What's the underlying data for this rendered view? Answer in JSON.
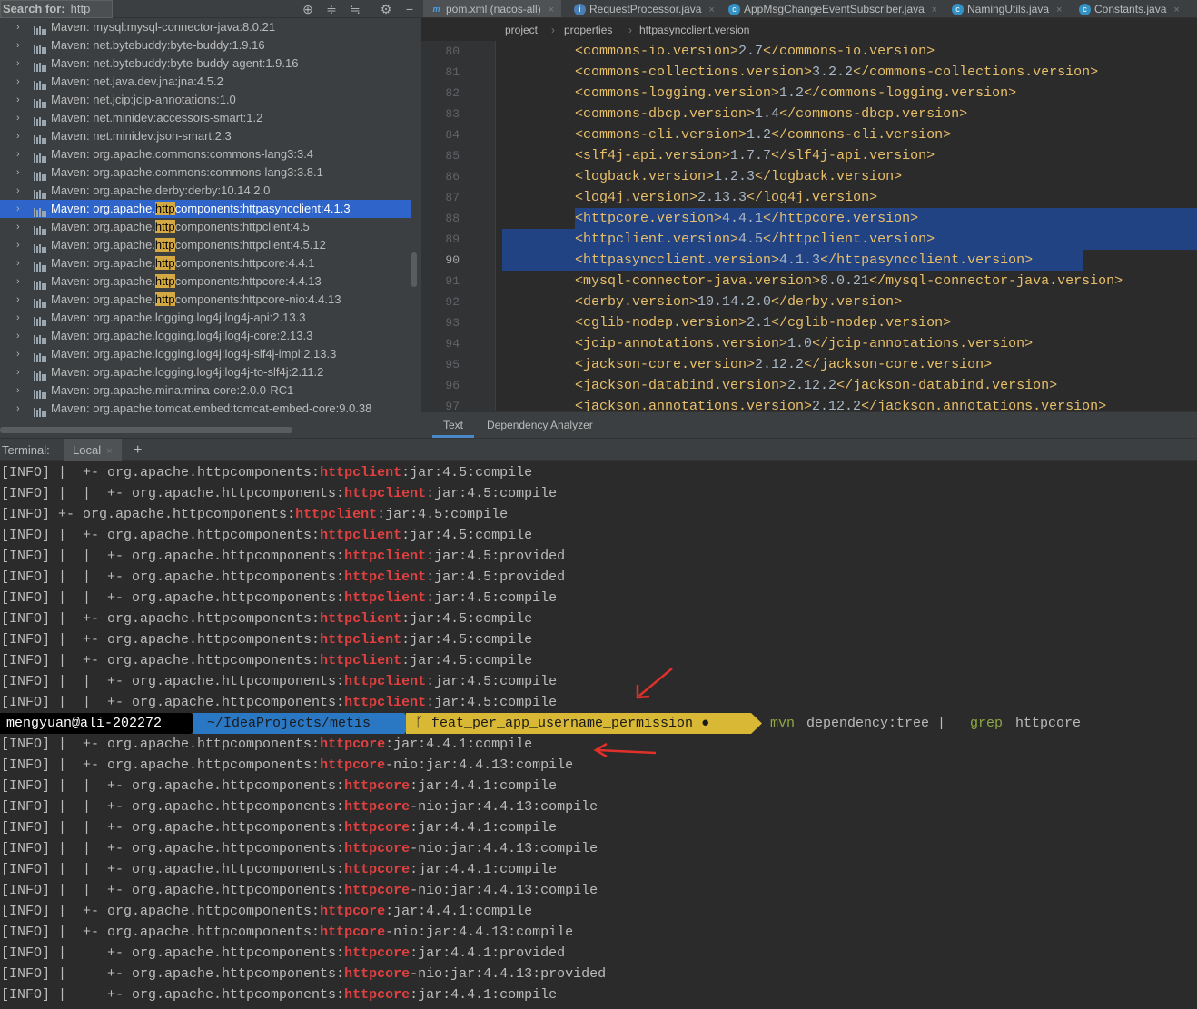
{
  "search": {
    "label": "Search for:",
    "value": "http"
  },
  "toolbar_icons": [
    "crosshair-icon",
    "expand-all-icon",
    "collapse-all-icon",
    "gear-icon",
    "minimize-icon"
  ],
  "tree": [
    {
      "text": "Maven: mysql:mysql-connector-java:8.0.21"
    },
    {
      "text": "Maven: net.bytebuddy:byte-buddy:1.9.16"
    },
    {
      "text": "Maven: net.bytebuddy:byte-buddy-agent:1.9.16"
    },
    {
      "text": "Maven: net.java.dev.jna:jna:4.5.2"
    },
    {
      "text": "Maven: net.jcip:jcip-annotations:1.0"
    },
    {
      "text": "Maven: net.minidev:accessors-smart:1.2"
    },
    {
      "text": "Maven: net.minidev:json-smart:2.3"
    },
    {
      "text": "Maven: org.apache.commons:commons-lang3:3.4"
    },
    {
      "text": "Maven: org.apache.commons:commons-lang3:3.8.1"
    },
    {
      "text": "Maven: org.apache.derby:derby:10.14.2.0"
    },
    {
      "pre": "Maven: org.apache.",
      "hl": "http",
      "post": "components:httpasyncclient:4.1.3",
      "selected": true
    },
    {
      "pre": "Maven: org.apache.",
      "hl": "http",
      "post": "components:httpclient:4.5"
    },
    {
      "pre": "Maven: org.apache.",
      "hl": "http",
      "post": "components:httpclient:4.5.12"
    },
    {
      "pre": "Maven: org.apache.",
      "hl": "http",
      "post": "components:httpcore:4.4.1"
    },
    {
      "pre": "Maven: org.apache.",
      "hl": "http",
      "post": "components:httpcore:4.4.13"
    },
    {
      "pre": "Maven: org.apache.",
      "hl": "http",
      "post": "components:httpcore-nio:4.4.13"
    },
    {
      "text": "Maven: org.apache.logging.log4j:log4j-api:2.13.3"
    },
    {
      "text": "Maven: org.apache.logging.log4j:log4j-core:2.13.3"
    },
    {
      "text": "Maven: org.apache.logging.log4j:log4j-slf4j-impl:2.13.3"
    },
    {
      "text": "Maven: org.apache.logging.log4j:log4j-to-slf4j:2.11.2"
    },
    {
      "text": "Maven: org.apache.mina:mina-core:2.0.0-RC1"
    },
    {
      "text": "Maven: org.apache.tomcat.embed:tomcat-embed-core:9.0.38"
    }
  ],
  "tabs": [
    {
      "label": "pom.xml (nacos-all)",
      "icon": "m",
      "active": true
    },
    {
      "label": "RequestProcessor.java",
      "icon": "i"
    },
    {
      "label": "AppMsgChangeEventSubscriber.java",
      "icon": "c"
    },
    {
      "label": "NamingUtils.java",
      "icon": "c"
    },
    {
      "label": "Constants.java",
      "icon": "c"
    }
  ],
  "breadcrumb": [
    "project",
    "properties",
    "httpasyncclient.version"
  ],
  "code_lines": [
    {
      "n": "80",
      "tag": "commons-io.version",
      "val": "2.7"
    },
    {
      "n": "81",
      "tag": "commons-collections.version",
      "val": "3.2.2"
    },
    {
      "n": "82",
      "tag": "commons-logging.version",
      "val": "1.2"
    },
    {
      "n": "83",
      "tag": "commons-dbcp.version",
      "val": "1.4"
    },
    {
      "n": "84",
      "tag": "commons-cli.version",
      "val": "1.2"
    },
    {
      "n": "85",
      "tag": "slf4j-api.version",
      "val": "1.7.7"
    },
    {
      "n": "86",
      "tag": "logback.version",
      "val": "1.2.3"
    },
    {
      "n": "87",
      "tag": "log4j.version",
      "val": "2.13.3"
    },
    {
      "n": "88",
      "tag": "httpcore.version",
      "val": "4.4.1",
      "sel": true
    },
    {
      "n": "89",
      "tag": "httpclient.version",
      "val": "4.5",
      "sel": true
    },
    {
      "n": "90",
      "tag": "httpasyncclient.version",
      "val": "4.1.3",
      "sel": true
    },
    {
      "n": "91",
      "tag": "mysql-connector-java.version",
      "val": "8.0.21"
    },
    {
      "n": "92",
      "tag": "derby.version",
      "val": "10.14.2.0"
    },
    {
      "n": "93",
      "tag": "cglib-nodep.version",
      "val": "2.1"
    },
    {
      "n": "94",
      "tag": "jcip-annotations.version",
      "val": "1.0"
    },
    {
      "n": "95",
      "tag": "jackson-core.version",
      "val": "2.12.2"
    },
    {
      "n": "96",
      "tag": "jackson-databind.version",
      "val": "2.12.2"
    },
    {
      "n": "97",
      "tag": "jackson.annotations.version",
      "val": "2.12.2"
    }
  ],
  "editor_bottom_tabs": [
    "Text",
    "Dependency Analyzer"
  ],
  "terminal": {
    "label": "Terminal:",
    "tab": "Local",
    "add": "+",
    "lines_before": [
      {
        "pre": "[INFO] |  +- org.apache.httpcomponents:",
        "m": "httpclient",
        "post": ":jar:4.5:compile"
      },
      {
        "pre": "[INFO] |  |  +- org.apache.httpcomponents:",
        "m": "httpclient",
        "post": ":jar:4.5:compile"
      },
      {
        "pre": "[INFO] +- org.apache.httpcomponents:",
        "m": "httpclient",
        "post": ":jar:4.5:compile"
      },
      {
        "pre": "[INFO] |  +- org.apache.httpcomponents:",
        "m": "httpclient",
        "post": ":jar:4.5:compile"
      },
      {
        "pre": "[INFO] |  |  +- org.apache.httpcomponents:",
        "m": "httpclient",
        "post": ":jar:4.5:provided"
      },
      {
        "pre": "[INFO] |  |  +- org.apache.httpcomponents:",
        "m": "httpclient",
        "post": ":jar:4.5:provided"
      },
      {
        "pre": "[INFO] |  |  +- org.apache.httpcomponents:",
        "m": "httpclient",
        "post": ":jar:4.5:compile"
      },
      {
        "pre": "[INFO] |  +- org.apache.httpcomponents:",
        "m": "httpclient",
        "post": ":jar:4.5:compile"
      },
      {
        "pre": "[INFO] |  +- org.apache.httpcomponents:",
        "m": "httpclient",
        "post": ":jar:4.5:compile"
      },
      {
        "pre": "[INFO] |  +- org.apache.httpcomponents:",
        "m": "httpclient",
        "post": ":jar:4.5:compile"
      },
      {
        "pre": "[INFO] |  |  +- org.apache.httpcomponents:",
        "m": "httpclient",
        "post": ":jar:4.5:compile"
      },
      {
        "pre": "[INFO] |  |  +- org.apache.httpcomponents:",
        "m": "httpclient",
        "post": ":jar:4.5:compile"
      }
    ],
    "prompt": {
      "user": "mengyuan@ali-202272",
      "path": "~/IdeaProjects/metis",
      "branch": "feat_per_app_username_permission",
      "dot": "●",
      "cmd": "mvn",
      "args": "dependency:tree |",
      "grep": "grep",
      "pattern": "httpcore"
    },
    "lines_after": [
      {
        "pre": "[INFO] |  +- org.apache.httpcomponents:",
        "m": "httpcore",
        "post": ":jar:4.4.1:compile"
      },
      {
        "pre": "[INFO] |  +- org.apache.httpcomponents:",
        "m": "httpcore",
        "post": "-nio:jar:4.4.13:compile"
      },
      {
        "pre": "[INFO] |  |  +- org.apache.httpcomponents:",
        "m": "httpcore",
        "post": ":jar:4.4.1:compile"
      },
      {
        "pre": "[INFO] |  |  +- org.apache.httpcomponents:",
        "m": "httpcore",
        "post": "-nio:jar:4.4.13:compile"
      },
      {
        "pre": "[INFO] |  |  +- org.apache.httpcomponents:",
        "m": "httpcore",
        "post": ":jar:4.4.1:compile"
      },
      {
        "pre": "[INFO] |  |  +- org.apache.httpcomponents:",
        "m": "httpcore",
        "post": "-nio:jar:4.4.13:compile"
      },
      {
        "pre": "[INFO] |  |  +- org.apache.httpcomponents:",
        "m": "httpcore",
        "post": ":jar:4.4.1:compile"
      },
      {
        "pre": "[INFO] |  |  +- org.apache.httpcomponents:",
        "m": "httpcore",
        "post": "-nio:jar:4.4.13:compile"
      },
      {
        "pre": "[INFO] |  +- org.apache.httpcomponents:",
        "m": "httpcore",
        "post": ":jar:4.4.1:compile"
      },
      {
        "pre": "[INFO] |  +- org.apache.httpcomponents:",
        "m": "httpcore",
        "post": "-nio:jar:4.4.13:compile"
      },
      {
        "pre": "[INFO] |     +- org.apache.httpcomponents:",
        "m": "httpcore",
        "post": ":jar:4.4.1:provided"
      },
      {
        "pre": "[INFO] |     +- org.apache.httpcomponents:",
        "m": "httpcore",
        "post": "-nio:jar:4.4.13:provided"
      },
      {
        "pre": "[INFO] |     +- org.apache.httpcomponents:",
        "m": "httpcore",
        "post": ":jar:4.4.1:compile"
      }
    ]
  },
  "colors": {
    "match": "#e04040",
    "selection": "#214283",
    "tree_selection": "#2f65ca",
    "search_hl": "#d4a942",
    "xml_tag": "#e8bf6a",
    "annotation_arrow": "#e0302a"
  }
}
